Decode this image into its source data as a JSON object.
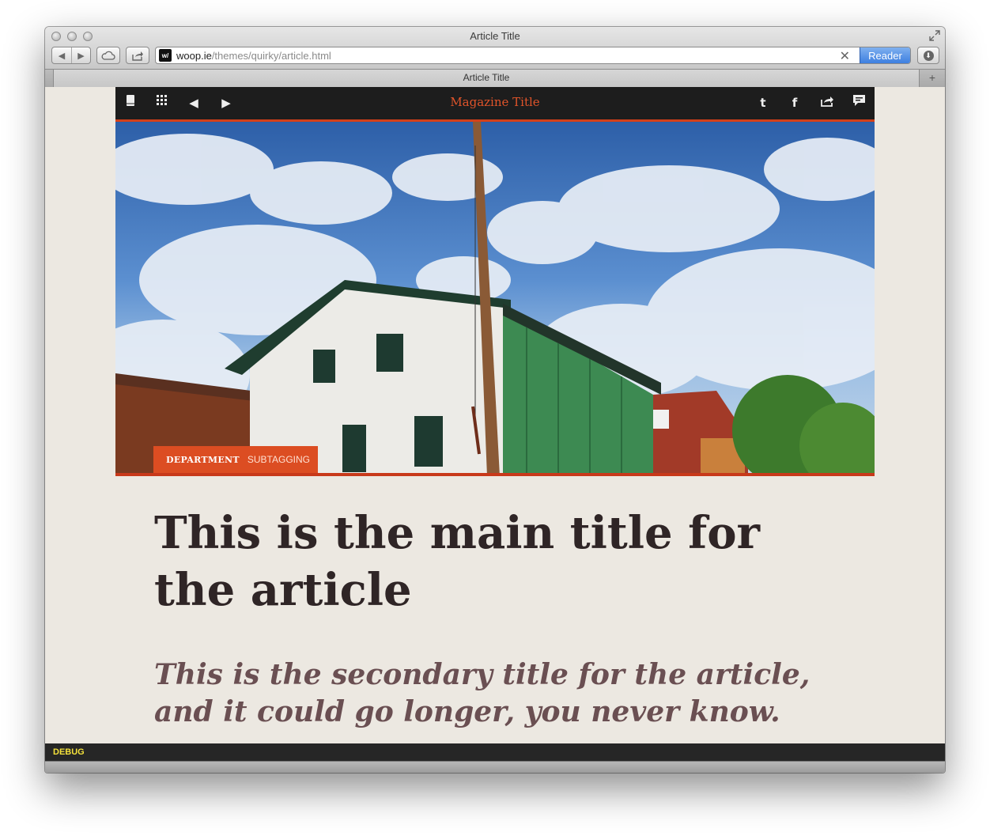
{
  "window": {
    "title": "Article Title",
    "tab_title": "Article Title",
    "url_host": "woop.ie",
    "url_path": "/themes/quirky/article.html",
    "favicon_text": "w/",
    "reader_label": "Reader",
    "new_tab": "+",
    "clear": "✕"
  },
  "toolbar": {
    "magazine_title": "Magazine Title",
    "icons": [
      "book-icon",
      "grid-icon",
      "prev-arrow-icon",
      "next-arrow-icon",
      "twitter-icon",
      "facebook-icon",
      "share-icon",
      "comment-icon"
    ],
    "accent": "#d4401a"
  },
  "article": {
    "department": "DEPARTMENT",
    "subtagging": "SUBTAGGING",
    "main_title": "This is the main title for the article",
    "secondary_title": "This is the secondary title for the article, and it could go longer, you never know."
  },
  "debug": {
    "label": "DEBUG"
  }
}
